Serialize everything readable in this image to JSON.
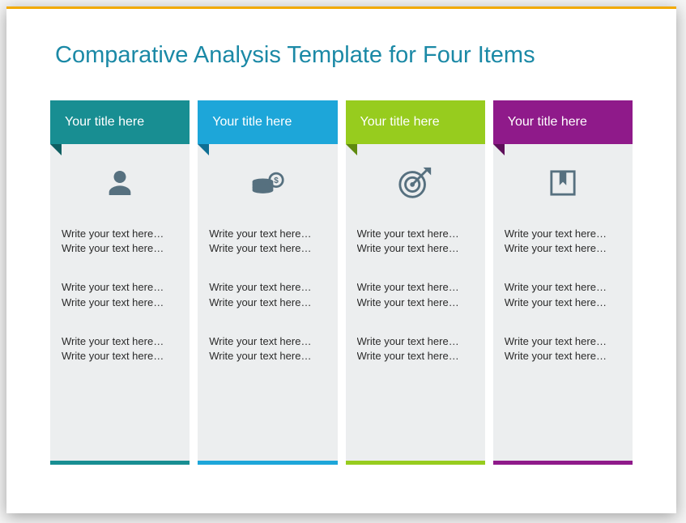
{
  "slide": {
    "title": "Comparative Analysis Template for Four Items"
  },
  "columns": [
    {
      "title": "Your title here",
      "icon": "person-icon",
      "color": "#188e92",
      "groups": [
        [
          "Write your text here…",
          "Write your text here…"
        ],
        [
          "Write your text here…",
          "Write your text here…"
        ],
        [
          "Write your text here…",
          "Write your text here…"
        ]
      ]
    },
    {
      "title": "Your title here",
      "icon": "coins-icon",
      "color": "#1da6d9",
      "groups": [
        [
          "Write your text here…",
          "Write your text here…"
        ],
        [
          "Write your text here…",
          "Write your text here…"
        ],
        [
          "Write your text here…",
          "Write your text here…"
        ]
      ]
    },
    {
      "title": "Your title here",
      "icon": "target-icon",
      "color": "#97cc1e",
      "groups": [
        [
          "Write your text here…",
          "Write your text here…"
        ],
        [
          "Write your text here…",
          "Write your text here…"
        ],
        [
          "Write your text here…",
          "Write your text here…"
        ]
      ]
    },
    {
      "title": "Your title here",
      "icon": "bookmark-icon",
      "color": "#8f1a8a",
      "groups": [
        [
          "Write your text here…",
          "Write your text here…"
        ],
        [
          "Write your text here…",
          "Write your text here…"
        ],
        [
          "Write your text here…",
          "Write your text here…"
        ]
      ]
    }
  ]
}
